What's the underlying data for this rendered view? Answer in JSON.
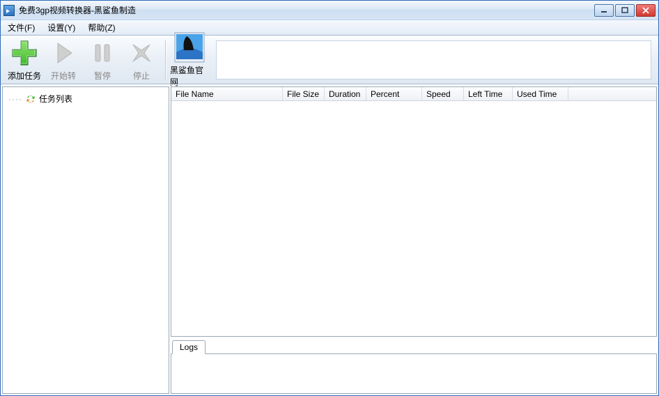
{
  "window": {
    "title": "免费3gp视频转换器-黑鲨鱼制造"
  },
  "menu": {
    "file": "文件(F)",
    "settings": "设置(Y)",
    "help": "帮助(Z)"
  },
  "toolbar": {
    "add_task": "添加任务",
    "start": "开始转",
    "pause": "暂停",
    "stop": "停止",
    "official": "黑鲨鱼官网"
  },
  "sidebar": {
    "task_list": "任务列表"
  },
  "table": {
    "columns": {
      "file_name": "File Name",
      "file_size": "File Size",
      "duration": "Duration",
      "percent": "Percent",
      "speed": "Speed",
      "left_time": "Left Time",
      "used_time": "Used Time"
    },
    "rows": []
  },
  "logs": {
    "tab_label": "Logs",
    "content": ""
  }
}
